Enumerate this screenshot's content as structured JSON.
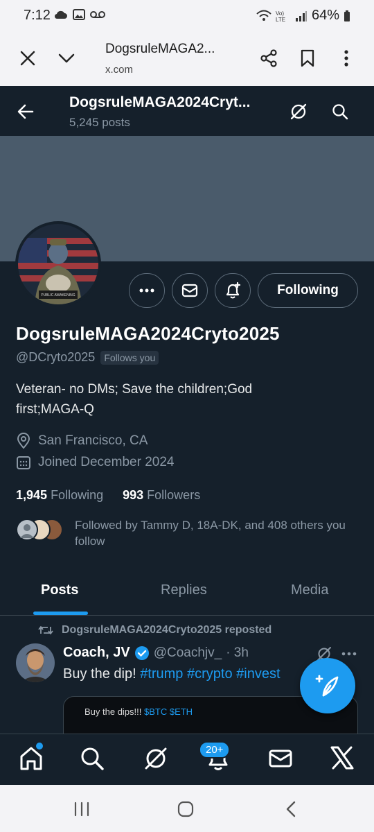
{
  "status": {
    "time": "7:12",
    "battery": "64%"
  },
  "browser": {
    "title": "DogsruleMAGA2...",
    "url": "x.com"
  },
  "header": {
    "name": "DogsruleMAGA2024Cryt...",
    "posts_count": "5,245 posts"
  },
  "profile": {
    "display_name": "DogsruleMAGA2024Cryto2025",
    "handle": "@DCryto2025",
    "follows_you": "Follows you",
    "follow_button": "Following",
    "bio": "Veteran- no DMs; Save the children;God first;MAGA-Q",
    "location": "San Francisco, CA",
    "joined": "Joined December 2024",
    "following_count": "1,945",
    "following_label": "Following",
    "followers_count": "993",
    "followers_label": "Followers",
    "followed_by": "Followed by Tammy D, 18A-DK, and 408 others you follow"
  },
  "tabs": [
    {
      "label": "Posts",
      "active": true
    },
    {
      "label": "Replies",
      "active": false
    },
    {
      "label": "Media",
      "active": false
    }
  ],
  "tweet": {
    "repost_label": "DogsruleMAGA2024Cryto2025 reposted",
    "author": "Coach, JV",
    "handle": "@Coachjv_",
    "time": "· 3h",
    "text_plain": "Buy the dip! ",
    "hashtags": "#trump #crypto #invest",
    "media_caption_prefix": "Buy the dips!!! ",
    "media_caption_tags": "$BTC $ETH"
  },
  "bottom_nav": {
    "notifications_badge": "20+"
  },
  "colors": {
    "background": "#15202b",
    "accent": "#1d9bf0",
    "banner": "#4a5b6b",
    "muted_text": "#8b98a5"
  },
  "icons": [
    "back-arrow-icon",
    "grok-icon",
    "search-icon",
    "more-icon",
    "mail-icon",
    "bell-plus-icon",
    "location-icon",
    "calendar-icon",
    "repost-icon",
    "verified-icon",
    "compose-icon",
    "home-icon",
    "notifications-icon",
    "x-logo-icon",
    "close-icon",
    "chevron-down-icon",
    "share-icon",
    "bookmark-icon",
    "kebab-icon"
  ]
}
